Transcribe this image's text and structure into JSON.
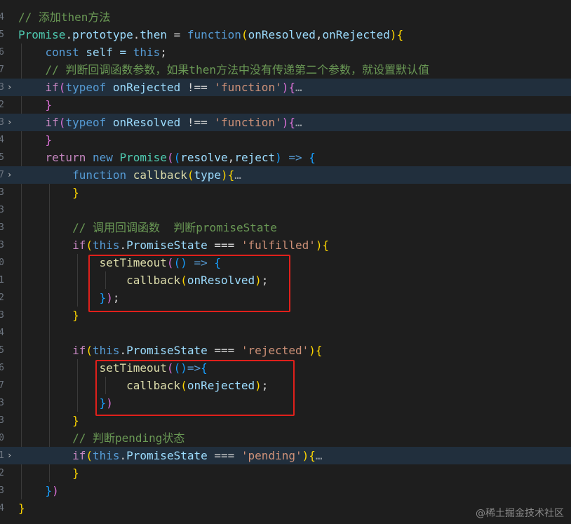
{
  "editor": {
    "line_numbers": [
      "4",
      "5",
      "6",
      "7",
      "3",
      "2",
      "3",
      "4",
      "5",
      "7",
      "3",
      "3",
      "3",
      "3",
      "0",
      "1",
      "2",
      "3",
      "4",
      "5",
      "6",
      "7",
      "3",
      "3",
      "0",
      "1",
      "2",
      "3",
      "4"
    ],
    "fold_glyph": "›",
    "ellipsis": "…",
    "lines": [
      {
        "tokens": [
          {
            "t": "// 添加then方法",
            "c": "comment"
          }
        ]
      },
      {
        "tokens": [
          {
            "t": "Promise",
            "c": "type"
          },
          {
            "t": ".",
            "c": "plain"
          },
          {
            "t": "prototype",
            "c": "prop"
          },
          {
            "t": ".",
            "c": "plain"
          },
          {
            "t": "then",
            "c": "prop"
          },
          {
            "t": " = ",
            "c": "plain"
          },
          {
            "t": "function",
            "c": "kw"
          },
          {
            "t": "(",
            "c": "b1"
          },
          {
            "t": "onResolved",
            "c": "prop"
          },
          {
            "t": ",",
            "c": "plain"
          },
          {
            "t": "onRejected",
            "c": "prop"
          },
          {
            "t": ")",
            "c": "b1"
          },
          {
            "t": "{",
            "c": "b1"
          }
        ]
      },
      {
        "tokens": [
          {
            "t": "    ",
            "c": "plain"
          },
          {
            "t": "const",
            "c": "kw"
          },
          {
            "t": " self = ",
            "c": "prop"
          },
          {
            "t": "this",
            "c": "kw"
          },
          {
            "t": ";",
            "c": "plain"
          }
        ]
      },
      {
        "tokens": [
          {
            "t": "    // 判断回调函数参数，如果then方法中没有传递第二个参数，就设置默认值",
            "c": "comment"
          }
        ]
      },
      {
        "tokens": [
          {
            "t": "    ",
            "c": "plain"
          },
          {
            "t": "if",
            "c": "ctrl"
          },
          {
            "t": "(",
            "c": "b2"
          },
          {
            "t": "typeof",
            "c": "kw"
          },
          {
            "t": " onRejected ",
            "c": "prop"
          },
          {
            "t": "!==",
            "c": "plain"
          },
          {
            "t": " ",
            "c": "plain"
          },
          {
            "t": "'function'",
            "c": "str"
          },
          {
            "t": ")",
            "c": "b2"
          },
          {
            "t": "{",
            "c": "b2"
          }
        ],
        "folded": true
      },
      {
        "tokens": [
          {
            "t": "    ",
            "c": "plain"
          },
          {
            "t": "}",
            "c": "b2"
          }
        ]
      },
      {
        "tokens": [
          {
            "t": "    ",
            "c": "plain"
          },
          {
            "t": "if",
            "c": "ctrl"
          },
          {
            "t": "(",
            "c": "b2"
          },
          {
            "t": "typeof",
            "c": "kw"
          },
          {
            "t": " onResolved ",
            "c": "prop"
          },
          {
            "t": "!==",
            "c": "plain"
          },
          {
            "t": " ",
            "c": "plain"
          },
          {
            "t": "'function'",
            "c": "str"
          },
          {
            "t": ")",
            "c": "b2"
          },
          {
            "t": "{",
            "c": "b2"
          }
        ],
        "folded": true
      },
      {
        "tokens": [
          {
            "t": "    ",
            "c": "plain"
          },
          {
            "t": "}",
            "c": "b2"
          }
        ]
      },
      {
        "tokens": [
          {
            "t": "    ",
            "c": "plain"
          },
          {
            "t": "return",
            "c": "ctrl"
          },
          {
            "t": " ",
            "c": "plain"
          },
          {
            "t": "new",
            "c": "kw"
          },
          {
            "t": " ",
            "c": "plain"
          },
          {
            "t": "Promise",
            "c": "type"
          },
          {
            "t": "(",
            "c": "b2"
          },
          {
            "t": "(",
            "c": "b3"
          },
          {
            "t": "resolve",
            "c": "prop"
          },
          {
            "t": ",",
            "c": "plain"
          },
          {
            "t": "reject",
            "c": "prop"
          },
          {
            "t": ")",
            "c": "b3"
          },
          {
            "t": " ",
            "c": "plain"
          },
          {
            "t": "=>",
            "c": "kw"
          },
          {
            "t": " ",
            "c": "plain"
          },
          {
            "t": "{",
            "c": "b3"
          }
        ]
      },
      {
        "tokens": [
          {
            "t": "        ",
            "c": "plain"
          },
          {
            "t": "function",
            "c": "kw"
          },
          {
            "t": " ",
            "c": "plain"
          },
          {
            "t": "callback",
            "c": "func"
          },
          {
            "t": "(",
            "c": "b1"
          },
          {
            "t": "type",
            "c": "prop"
          },
          {
            "t": ")",
            "c": "b1"
          },
          {
            "t": "{",
            "c": "b1"
          }
        ],
        "folded": true
      },
      {
        "tokens": [
          {
            "t": "        ",
            "c": "plain"
          },
          {
            "t": "}",
            "c": "b1"
          }
        ]
      },
      {
        "tokens": []
      },
      {
        "tokens": [
          {
            "t": "        // 调用回调函数  判断promiseState",
            "c": "comment"
          }
        ]
      },
      {
        "tokens": [
          {
            "t": "        ",
            "c": "plain"
          },
          {
            "t": "if",
            "c": "ctrl"
          },
          {
            "t": "(",
            "c": "b1"
          },
          {
            "t": "this",
            "c": "kw"
          },
          {
            "t": ".",
            "c": "plain"
          },
          {
            "t": "PromiseState",
            "c": "prop"
          },
          {
            "t": " === ",
            "c": "plain"
          },
          {
            "t": "'fulfilled'",
            "c": "str"
          },
          {
            "t": ")",
            "c": "b1"
          },
          {
            "t": "{",
            "c": "b1"
          }
        ]
      },
      {
        "tokens": [
          {
            "t": "            ",
            "c": "plain"
          },
          {
            "t": "setTimeout",
            "c": "func"
          },
          {
            "t": "(",
            "c": "b2"
          },
          {
            "t": "()",
            "c": "b3"
          },
          {
            "t": " ",
            "c": "plain"
          },
          {
            "t": "=>",
            "c": "kw"
          },
          {
            "t": " ",
            "c": "plain"
          },
          {
            "t": "{",
            "c": "b3"
          }
        ]
      },
      {
        "tokens": [
          {
            "t": "                ",
            "c": "plain"
          },
          {
            "t": "callback",
            "c": "func"
          },
          {
            "t": "(",
            "c": "b1"
          },
          {
            "t": "onResolved",
            "c": "prop"
          },
          {
            "t": ")",
            "c": "b1"
          },
          {
            "t": ";",
            "c": "plain"
          }
        ]
      },
      {
        "tokens": [
          {
            "t": "            ",
            "c": "plain"
          },
          {
            "t": "}",
            "c": "b3"
          },
          {
            "t": ")",
            "c": "b2"
          },
          {
            "t": ";",
            "c": "plain"
          }
        ]
      },
      {
        "tokens": [
          {
            "t": "        ",
            "c": "plain"
          },
          {
            "t": "}",
            "c": "b1"
          }
        ]
      },
      {
        "tokens": []
      },
      {
        "tokens": [
          {
            "t": "        ",
            "c": "plain"
          },
          {
            "t": "if",
            "c": "ctrl"
          },
          {
            "t": "(",
            "c": "b1"
          },
          {
            "t": "this",
            "c": "kw"
          },
          {
            "t": ".",
            "c": "plain"
          },
          {
            "t": "PromiseState",
            "c": "prop"
          },
          {
            "t": " === ",
            "c": "plain"
          },
          {
            "t": "'rejected'",
            "c": "str"
          },
          {
            "t": ")",
            "c": "b1"
          },
          {
            "t": "{",
            "c": "b1"
          }
        ]
      },
      {
        "tokens": [
          {
            "t": "            ",
            "c": "plain"
          },
          {
            "t": "setTimeout",
            "c": "func"
          },
          {
            "t": "(",
            "c": "b2"
          },
          {
            "t": "()",
            "c": "b3"
          },
          {
            "t": "=>",
            "c": "kw"
          },
          {
            "t": "{",
            "c": "b3"
          }
        ]
      },
      {
        "tokens": [
          {
            "t": "                ",
            "c": "plain"
          },
          {
            "t": "callback",
            "c": "func"
          },
          {
            "t": "(",
            "c": "b1"
          },
          {
            "t": "onRejected",
            "c": "prop"
          },
          {
            "t": ")",
            "c": "b1"
          },
          {
            "t": ";",
            "c": "plain"
          }
        ]
      },
      {
        "tokens": [
          {
            "t": "            ",
            "c": "plain"
          },
          {
            "t": "}",
            "c": "b3"
          },
          {
            "t": ")",
            "c": "b2"
          }
        ]
      },
      {
        "tokens": [
          {
            "t": "        ",
            "c": "plain"
          },
          {
            "t": "}",
            "c": "b1"
          }
        ]
      },
      {
        "tokens": [
          {
            "t": "        // 判断pending状态",
            "c": "comment"
          }
        ]
      },
      {
        "tokens": [
          {
            "t": "        ",
            "c": "plain"
          },
          {
            "t": "if",
            "c": "ctrl"
          },
          {
            "t": "(",
            "c": "b1"
          },
          {
            "t": "this",
            "c": "kw"
          },
          {
            "t": ".",
            "c": "plain"
          },
          {
            "t": "PromiseState",
            "c": "prop"
          },
          {
            "t": " === ",
            "c": "plain"
          },
          {
            "t": "'pending'",
            "c": "str"
          },
          {
            "t": ")",
            "c": "b1"
          },
          {
            "t": "{",
            "c": "b1"
          }
        ],
        "folded": true
      },
      {
        "tokens": [
          {
            "t": "        ",
            "c": "plain"
          },
          {
            "t": "}",
            "c": "b1"
          }
        ]
      },
      {
        "tokens": [
          {
            "t": "    ",
            "c": "plain"
          },
          {
            "t": "}",
            "c": "b3"
          },
          {
            "t": ")",
            "c": "b2"
          }
        ]
      },
      {
        "tokens": [
          {
            "t": "}",
            "c": "b1"
          }
        ]
      }
    ]
  },
  "watermark": "@稀土掘金技术社区",
  "colors": {
    "highlight_box": "#e0201b",
    "folded_bg": "#212f3d",
    "background": "#1e1e1e"
  }
}
